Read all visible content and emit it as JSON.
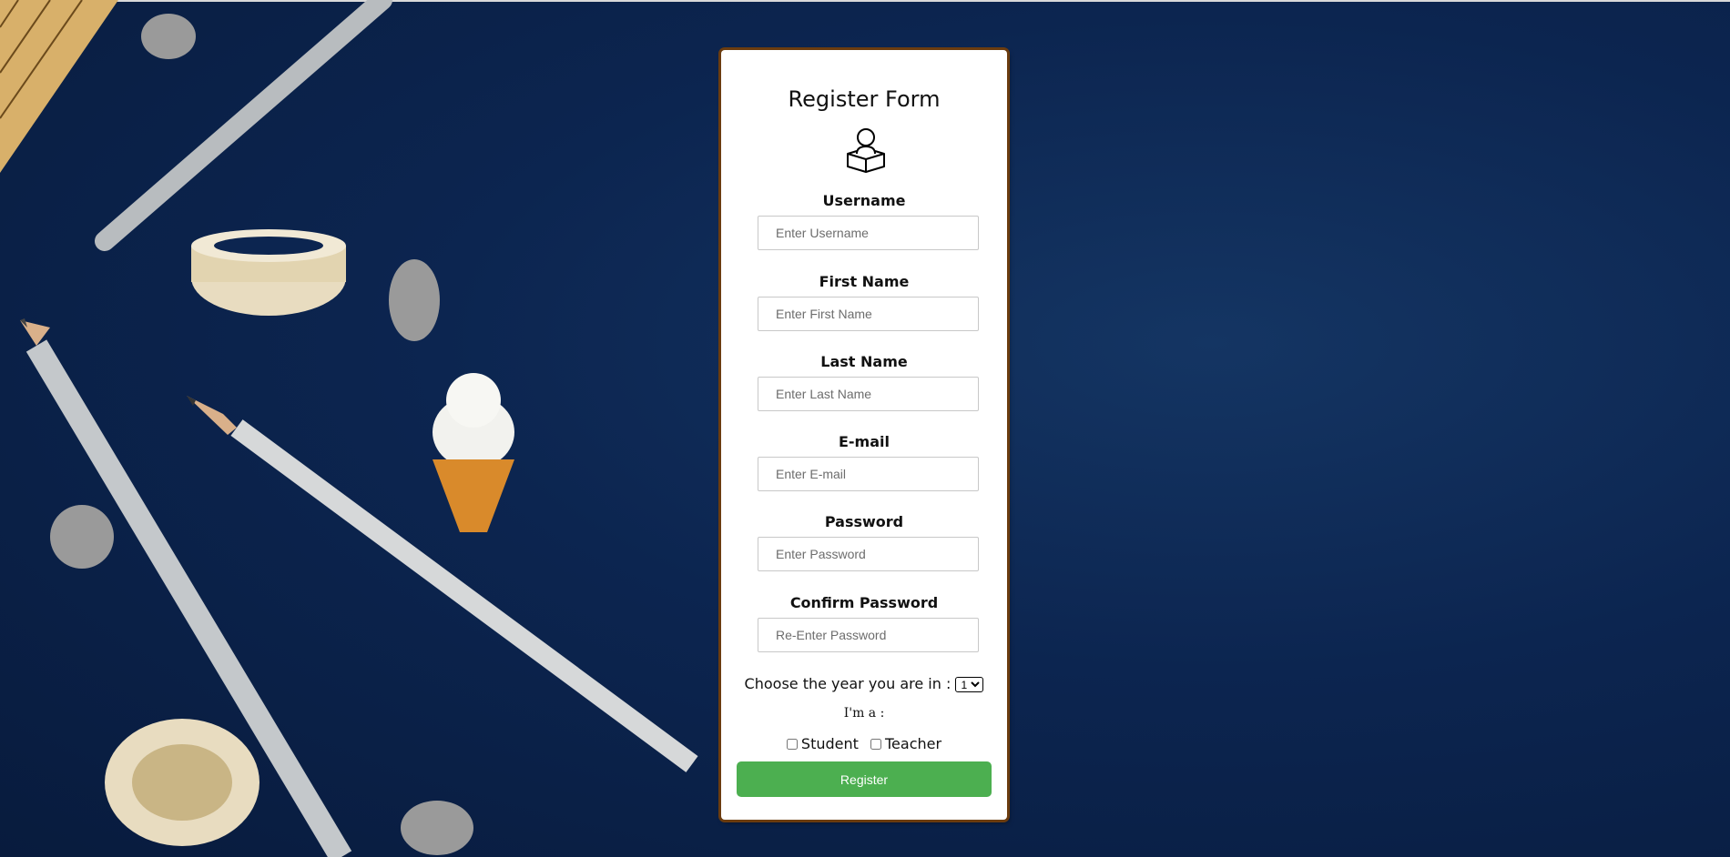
{
  "form": {
    "title": "Register Form",
    "fields": [
      {
        "label": "Username",
        "placeholder": "Enter Username",
        "value": ""
      },
      {
        "label": "First Name",
        "placeholder": "Enter First Name",
        "value": ""
      },
      {
        "label": "Last Name",
        "placeholder": "Enter Last Name",
        "value": ""
      },
      {
        "label": "E-mail",
        "placeholder": "Enter E-mail",
        "value": ""
      },
      {
        "label": "Password",
        "placeholder": "Enter Password",
        "value": ""
      },
      {
        "label": "Confirm Password",
        "placeholder": "Re-Enter Password",
        "value": ""
      }
    ],
    "year_label": "Choose the year you are in :",
    "year_selected": "1",
    "role_label": "I'm a :",
    "roles": [
      {
        "label": "Student",
        "checked": false
      },
      {
        "label": "Teacher",
        "checked": false
      }
    ],
    "register_label": "Register"
  },
  "colors": {
    "background": "#0c2550",
    "card_border": "#6b3c0f",
    "register_button": "#4caf50"
  },
  "icons": {
    "form_icon": "user-with-book-icon"
  }
}
